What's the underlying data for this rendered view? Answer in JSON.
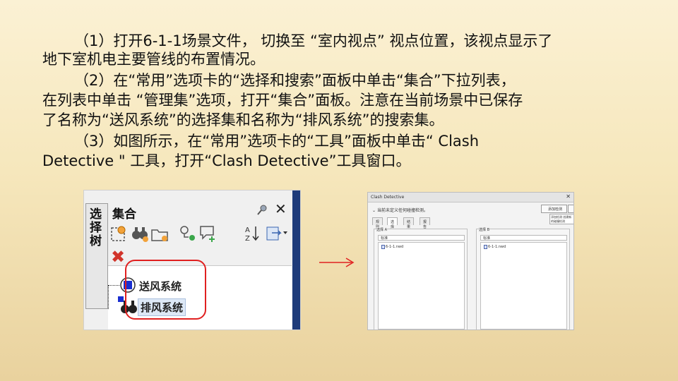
{
  "paragraphs": [
    {
      "line1": "（1）打开6-1-1场景文件， 切换至 “室内视点” 视点位置，该视点显示了",
      "line2": "地下室机电主要管线的布置情况。"
    },
    {
      "line1": "（2）在“常用”选项卡的“选择和搜索”面板中单击“集合”下拉列表，",
      "line2": "在列表中单击 “管理集”选项，打开“集合”面板。注意在当前场景中已保存",
      "line3": "了名称为“送风系统”的选择集和名称为“排风系统”的搜索集。"
    },
    {
      "line1": "（3）如图所示，在“常用”选项卡的“工具”面板中单击“ Clash",
      "line2": "Detective \" 工具，打开“Clash Detective”工具窗口。"
    }
  ],
  "sets_panel": {
    "side_tab": "选择树",
    "title": "集合",
    "items": [
      {
        "label": "送风系统",
        "icon": "selection-set-icon"
      },
      {
        "label": "排风系统",
        "icon": "search-set-binoculars-icon"
      }
    ]
  },
  "clash_window": {
    "title": "Clash Detective",
    "status": "当前未定义任何碰撞检测。",
    "add_button": "添加检测",
    "tooltip": "添加检测 创建新的碰撞检测",
    "tabs": [
      "规则",
      "选择",
      "结果",
      "报告"
    ],
    "selection_a": {
      "label": "选择 A",
      "mode": "标准",
      "file": "6-1-1.nwd"
    },
    "selection_b": {
      "label": "选择 B",
      "mode": "标准",
      "file": "6-1-1.nwd"
    }
  },
  "colors": {
    "highlight": "#e02020",
    "arrow": "#e02020",
    "set_icon_blue": "#1a2fd0"
  }
}
